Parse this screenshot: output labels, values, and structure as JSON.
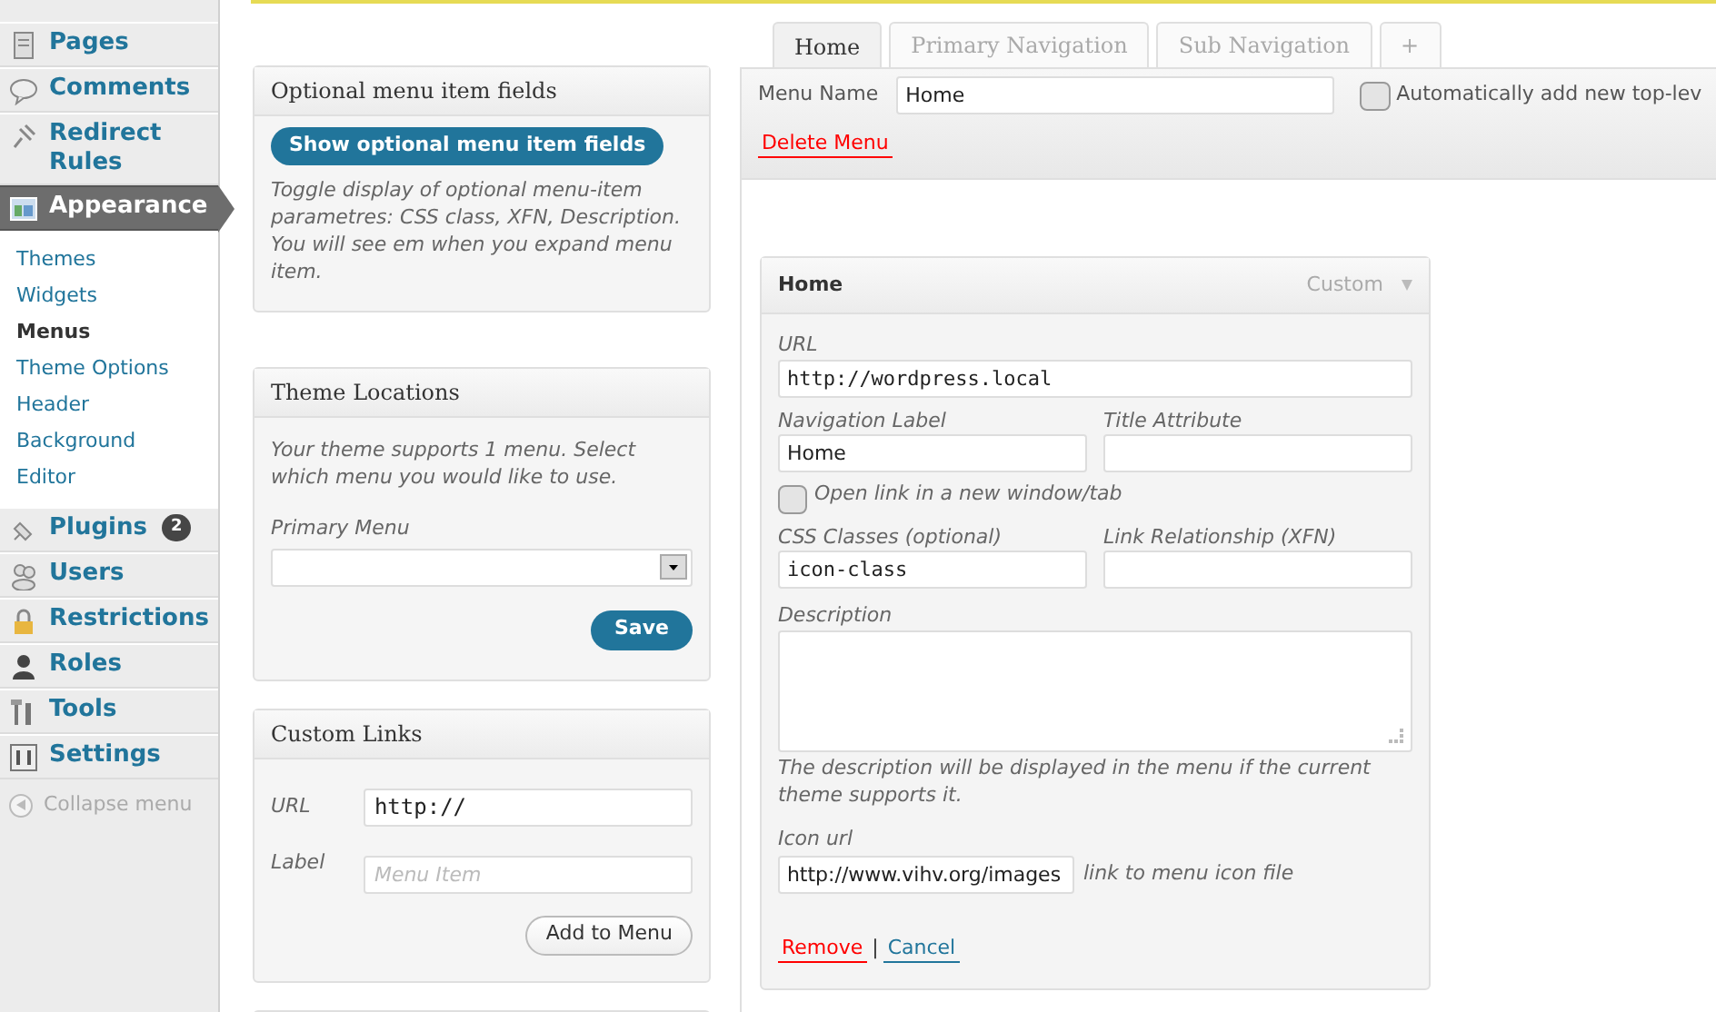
{
  "sidebar": {
    "items": [
      {
        "label": "Pages",
        "selected": false
      },
      {
        "label": "Comments",
        "selected": false
      },
      {
        "label": "Redirect Rules",
        "selected": false
      },
      {
        "label": "Appearance",
        "selected": true,
        "children": [
          {
            "label": "Themes",
            "selected": false
          },
          {
            "label": "Widgets",
            "selected": false
          },
          {
            "label": "Menus",
            "selected": true
          },
          {
            "label": "Theme Options",
            "selected": false
          },
          {
            "label": "Header",
            "selected": false
          },
          {
            "label": "Background",
            "selected": false
          },
          {
            "label": "Editor",
            "selected": false
          }
        ]
      },
      {
        "label": "Plugins",
        "selected": false,
        "badge": "2"
      },
      {
        "label": "Users",
        "selected": false
      },
      {
        "label": "Restrictions",
        "selected": false
      },
      {
        "label": "Roles",
        "selected": false
      },
      {
        "label": "Tools",
        "selected": false
      },
      {
        "label": "Settings",
        "selected": false
      }
    ],
    "collapse": "Collapse menu"
  },
  "optional_fields": {
    "title": "Optional menu item fields",
    "button": "Show optional menu item fields",
    "description": "Toggle display of optional menu-item parametres: CSS class, XFN, Description. You will see em when you expand menu item."
  },
  "theme_locations": {
    "title": "Theme Locations",
    "description": "Your theme supports 1 menu. Select which menu you would like to use.",
    "field_label": "Primary Menu",
    "button": "Save"
  },
  "custom_links": {
    "title": "Custom Links",
    "url_label": "URL",
    "url_value": "http://",
    "label_label": "Label",
    "label_placeholder": "Menu Item",
    "button": "Add to Menu"
  },
  "tabs": [
    {
      "label": "Home",
      "selected": true
    },
    {
      "label": "Primary Navigation",
      "selected": false
    },
    {
      "label": "Sub Navigation",
      "selected": false
    },
    {
      "label": "+",
      "selected": false
    }
  ],
  "menu_header": {
    "name_label": "Menu Name",
    "name_value": "Home",
    "auto_add_label": "Automatically add new top-lev",
    "auto_add_checked": false,
    "delete": "Delete Menu"
  },
  "menu_item": {
    "title": "Home",
    "type": "Custom",
    "url_label": "URL",
    "url_value": "http://wordpress.local",
    "nav_label": "Navigation Label",
    "nav_value": "Home",
    "title_attr_label": "Title Attribute",
    "new_window_label": "Open link in a new window/tab",
    "new_window_checked": false,
    "css_label": "CSS Classes (optional)",
    "css_value": "icon-class",
    "xfn_label": "Link Relationship (XFN)",
    "description_label": "Description",
    "description_hint": "The description will be displayed in the menu if the current theme supports it.",
    "icon_label": "Icon url",
    "icon_value": "http://www.vihv.org/images",
    "icon_hint": "link to menu icon file",
    "remove": "Remove",
    "separator": "|",
    "cancel": "Cancel"
  }
}
